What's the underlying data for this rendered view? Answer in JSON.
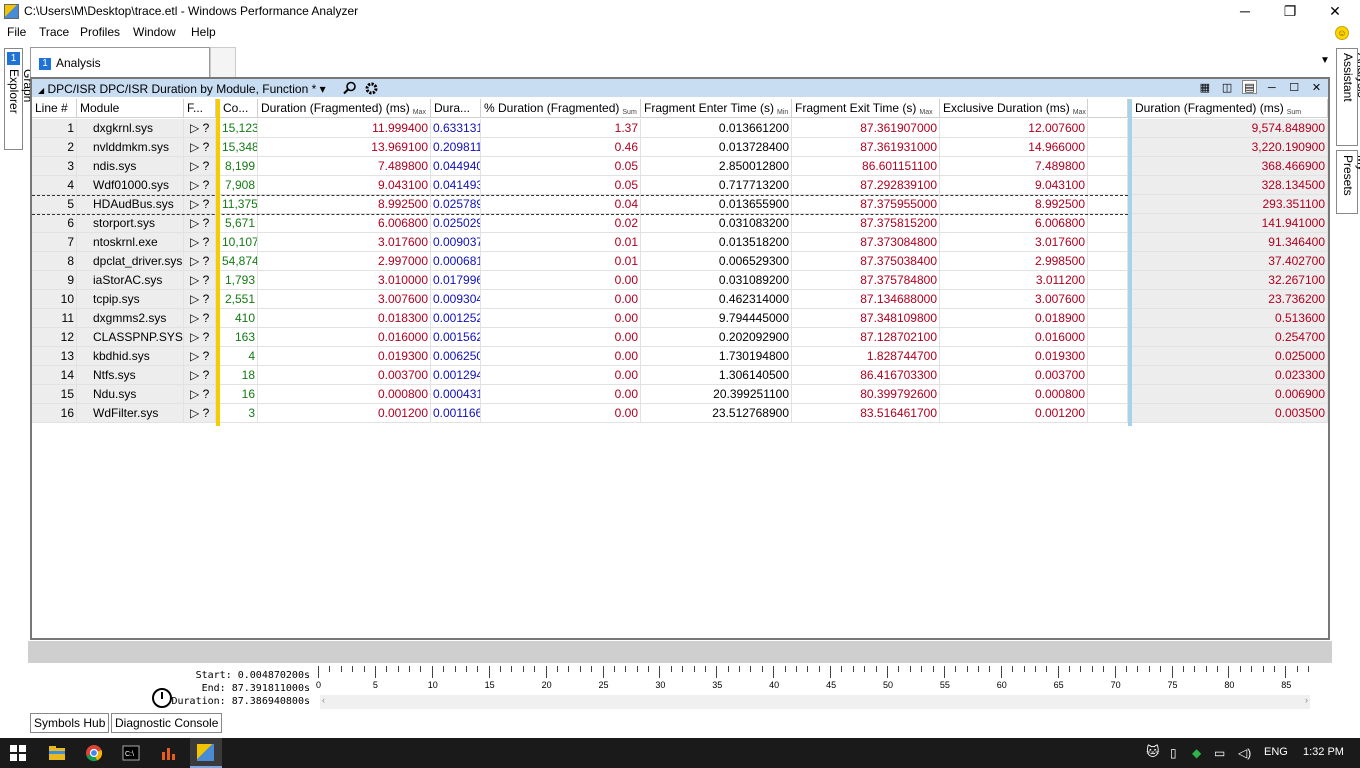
{
  "window": {
    "title": "C:\\Users\\M\\Desktop\\trace.etl - Windows Performance Analyzer",
    "minimize": "─",
    "maximize": "❐",
    "close": "✕"
  },
  "menu": [
    "File",
    "Trace",
    "Profiles",
    "Window",
    "Help"
  ],
  "left_tab": {
    "num": "1",
    "label": "Graph Explorer"
  },
  "right_tabs": [
    "Analysis Assistant",
    "My Presets"
  ],
  "analysis_tab": {
    "num": "1",
    "label": "Analysis"
  },
  "panel": {
    "title": "DPC/ISR  DPC/ISR Duration by Module, Function *",
    "collapse": "◢",
    "dropdown": "▾"
  },
  "columns": [
    {
      "label": "Line #",
      "sub": ""
    },
    {
      "label": "Module",
      "sub": ""
    },
    {
      "label": "F...",
      "sub": ""
    },
    {
      "label": "Co...",
      "sub": ""
    },
    {
      "label": "Duration (Fragmented) (ms)",
      "sub": "Max"
    },
    {
      "label": "Dura...",
      "sub": ""
    },
    {
      "label": "% Duration (Fragmented)",
      "sub": "Sum"
    },
    {
      "label": "Fragment Enter Time (s)",
      "sub": "Min"
    },
    {
      "label": "Fragment Exit Time (s)",
      "sub": "Max"
    },
    {
      "label": "Exclusive Duration (ms)",
      "sub": "Max"
    },
    {
      "label": "",
      "sub": ""
    },
    {
      "label": "Duration (Fragmented) (ms)",
      "sub": "Sum"
    }
  ],
  "rows": [
    {
      "line": "1",
      "module": "dxgkrnl.sys",
      "f": "▷ ?",
      "count": "15,123",
      "dur_max": "11.999400",
      "dura": "0.633131",
      "pct": "1.37",
      "enter": "0.013661200",
      "exit": "87.361907000",
      "excl": "12.007600",
      "dur_sum": "9,574.848900"
    },
    {
      "line": "2",
      "module": "nvlddmkm.sys",
      "f": "▷ ?",
      "count": "15,348",
      "dur_max": "13.969100",
      "dura": "0.209811",
      "pct": "0.46",
      "enter": "0.013728400",
      "exit": "87.361931000",
      "excl": "14.966000",
      "dur_sum": "3,220.190900"
    },
    {
      "line": "3",
      "module": "ndis.sys",
      "f": "▷ ?",
      "count": "8,199",
      "dur_max": "7.489800",
      "dura": "0.044940",
      "pct": "0.05",
      "enter": "2.850012800",
      "exit": "86.601151100",
      "excl": "7.489800",
      "dur_sum": "368.466900"
    },
    {
      "line": "4",
      "module": "Wdf01000.sys",
      "f": "▷ ?",
      "count": "7,908",
      "dur_max": "9.043100",
      "dura": "0.041493",
      "pct": "0.05",
      "enter": "0.717713200",
      "exit": "87.292839100",
      "excl": "9.043100",
      "dur_sum": "328.134500"
    },
    {
      "line": "5",
      "module": "HDAudBus.sys",
      "f": "▷ ?",
      "count": "11,375",
      "dur_max": "8.992500",
      "dura": "0.025789",
      "pct": "0.04",
      "enter": "0.013655900",
      "exit": "87.375955000",
      "excl": "8.992500",
      "dur_sum": "293.351100"
    },
    {
      "line": "6",
      "module": "storport.sys",
      "f": "▷ ?",
      "count": "5,671",
      "dur_max": "6.006800",
      "dura": "0.025029",
      "pct": "0.02",
      "enter": "0.031083200",
      "exit": "87.375815200",
      "excl": "6.006800",
      "dur_sum": "141.941000"
    },
    {
      "line": "7",
      "module": "ntoskrnl.exe",
      "f": "▷ ?",
      "count": "10,107",
      "dur_max": "3.017600",
      "dura": "0.009037",
      "pct": "0.01",
      "enter": "0.013518200",
      "exit": "87.373084800",
      "excl": "3.017600",
      "dur_sum": "91.346400"
    },
    {
      "line": "8",
      "module": "dpclat_driver.sys",
      "f": "▷ ?",
      "count": "54,874",
      "dur_max": "2.997000",
      "dura": "0.000681",
      "pct": "0.01",
      "enter": "0.006529300",
      "exit": "87.375038400",
      "excl": "2.998500",
      "dur_sum": "37.402700"
    },
    {
      "line": "9",
      "module": "iaStorAC.sys",
      "f": "▷ ?",
      "count": "1,793",
      "dur_max": "3.010000",
      "dura": "0.017996",
      "pct": "0.00",
      "enter": "0.031089200",
      "exit": "87.375784800",
      "excl": "3.011200",
      "dur_sum": "32.267100"
    },
    {
      "line": "10",
      "module": "tcpip.sys",
      "f": "▷ ?",
      "count": "2,551",
      "dur_max": "3.007600",
      "dura": "0.009304",
      "pct": "0.00",
      "enter": "0.462314000",
      "exit": "87.134688000",
      "excl": "3.007600",
      "dur_sum": "23.736200"
    },
    {
      "line": "11",
      "module": "dxgmms2.sys",
      "f": "▷ ?",
      "count": "410",
      "dur_max": "0.018300",
      "dura": "0.001252",
      "pct": "0.00",
      "enter": "9.794445000",
      "exit": "87.348109800",
      "excl": "0.018900",
      "dur_sum": "0.513600"
    },
    {
      "line": "12",
      "module": "CLASSPNP.SYS",
      "f": "▷ ?",
      "count": "163",
      "dur_max": "0.016000",
      "dura": "0.001562",
      "pct": "0.00",
      "enter": "0.202092900",
      "exit": "87.128702100",
      "excl": "0.016000",
      "dur_sum": "0.254700"
    },
    {
      "line": "13",
      "module": "kbdhid.sys",
      "f": "▷ ?",
      "count": "4",
      "dur_max": "0.019300",
      "dura": "0.006250",
      "pct": "0.00",
      "enter": "1.730194800",
      "exit": "1.828744700",
      "excl": "0.019300",
      "dur_sum": "0.025000"
    },
    {
      "line": "14",
      "module": "Ntfs.sys",
      "f": "▷ ?",
      "count": "18",
      "dur_max": "0.003700",
      "dura": "0.001294",
      "pct": "0.00",
      "enter": "1.306140500",
      "exit": "86.416703300",
      "excl": "0.003700",
      "dur_sum": "0.023300"
    },
    {
      "line": "15",
      "module": "Ndu.sys",
      "f": "▷ ?",
      "count": "16",
      "dur_max": "0.000800",
      "dura": "0.000431",
      "pct": "0.00",
      "enter": "20.399251100",
      "exit": "80.399792600",
      "excl": "0.000800",
      "dur_sum": "0.006900"
    },
    {
      "line": "16",
      "module": "WdFilter.sys",
      "f": "▷ ?",
      "count": "3",
      "dur_max": "0.001200",
      "dura": "0.001166",
      "pct": "0.00",
      "enter": "23.512768900",
      "exit": "83.516461700",
      "excl": "0.001200",
      "dur_sum": "0.003500"
    }
  ],
  "timeline": {
    "start_label": "Start:",
    "start_value": "0.004870200s",
    "end_label": "End:",
    "end_value": "87.391811000s",
    "duration_label": "Duration:",
    "duration_value": "87.386940800s",
    "ticks": [
      "0",
      "5",
      "10",
      "15",
      "20",
      "25",
      "30",
      "35",
      "40",
      "45",
      "50",
      "55",
      "60",
      "65",
      "70",
      "75",
      "80",
      "85"
    ]
  },
  "bottom_buttons": {
    "symbols": "Symbols Hub",
    "diagnostic": "Diagnostic Console"
  },
  "taskbar": {
    "lang": "ENG",
    "time": "1:32 PM"
  },
  "colors": {
    "header_blue": "#c8dcf2",
    "yellow_separator": "#f5cd00",
    "blue_separator": "#a8d2ea",
    "red_text": "#b00020",
    "blue_text": "#1010b8",
    "green_text": "#157a15"
  }
}
